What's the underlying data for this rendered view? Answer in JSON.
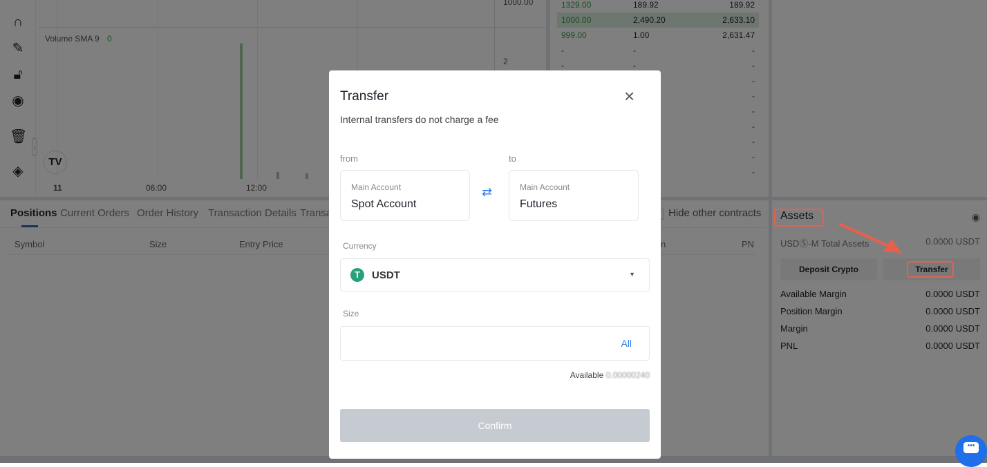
{
  "chart": {
    "indicator": "Volume SMA 9",
    "indicator_value": "0",
    "x_ticks": [
      "11",
      "06:00",
      "12:00"
    ],
    "price_ticks": [
      "1000.00",
      "2"
    ]
  },
  "orderbook": {
    "rows": [
      [
        "1329.00",
        "189.92",
        "189.92"
      ],
      [
        "1000.00",
        "2,490.20",
        "2,633.10"
      ],
      [
        "999.00",
        "1.00",
        "2,631.47"
      ],
      [
        "-",
        "-",
        "-"
      ],
      [
        "-",
        "-",
        "-"
      ],
      [
        "-",
        "-",
        "-"
      ],
      [
        "-",
        "-",
        "-"
      ],
      [
        "-",
        "-",
        "-"
      ],
      [
        "-",
        "-",
        "-"
      ],
      [
        "-",
        "-",
        "-"
      ],
      [
        "-",
        "-",
        "-"
      ],
      [
        "-",
        "-",
        "-"
      ]
    ]
  },
  "tabs": [
    "Positions",
    "Current Orders",
    "Order History",
    "Transaction Details",
    "Transa"
  ],
  "hide_other": "Hide other contracts",
  "columns": [
    "Symbol",
    "Size",
    "Entry Price",
    "n",
    "PN"
  ],
  "assets": {
    "title": "Assets",
    "total_label": "USDⓈ-M Total Assets",
    "total_value": "0.0000 USDT",
    "deposit": "Deposit Crypto",
    "transfer": "Transfer",
    "rows": [
      {
        "label": "Available Margin",
        "value": "0.0000 USDT"
      },
      {
        "label": "Position Margin",
        "value": "0.0000 USDT"
      },
      {
        "label": "Margin",
        "value": "0.0000 USDT"
      },
      {
        "label": "PNL",
        "value": "0.0000 USDT"
      }
    ]
  },
  "modal": {
    "title": "Transfer",
    "subtitle": "Internal transfers do not charge a fee",
    "from_label": "from",
    "to_label": "to",
    "from": {
      "type": "Main Account",
      "name": "Spot Account"
    },
    "to": {
      "type": "Main Account",
      "name": "Futures"
    },
    "currency_label": "Currency",
    "currency": "USDT",
    "size_label": "Size",
    "size_value": "",
    "all": "All",
    "available_label": "Available",
    "available_value": "0.00000240",
    "confirm": "Confirm"
  },
  "colors": {
    "accent": "#2b7de9",
    "highlight": "#e8604c",
    "usdt": "#26a17b"
  }
}
